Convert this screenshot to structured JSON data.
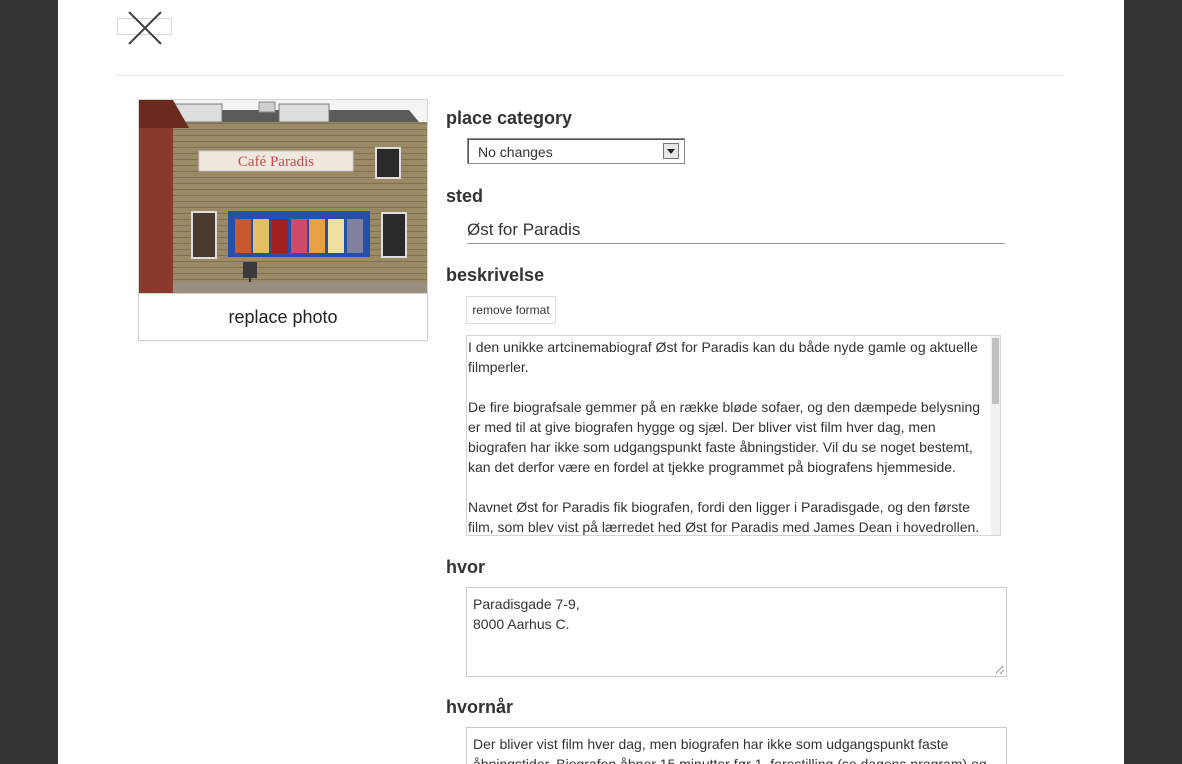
{
  "photo_card": {
    "replace_label": "replace photo",
    "photo_sign": "Café Paradis"
  },
  "form": {
    "category": {
      "label": "place category",
      "selected": "No changes"
    },
    "sted": {
      "label": "sted",
      "value": "Øst for Paradis"
    },
    "beskrivelse": {
      "label": "beskrivelse",
      "remove_format_label": "remove format",
      "paragraphs": [
        "I den unikke artcinemabiograf Øst for Paradis kan du både nyde gamle og aktuelle filmperler.",
        "De fire biografsale gemmer på en række bløde sofaer, og den dæmpede belysning er med til at give biografen hygge og sjæl. Der bliver vist film hver dag, men biografen har ikke som udgangspunkt faste åbningstider. Vil du se noget bestemt, kan det derfor være en fordel at tjekke programmet på biografens hjemmeside.",
        "Navnet Øst for Paradis fik biografen, fordi den ligger i Paradisgade, og den første film, som blev vist på lærredet hed Øst for Paradis med James Dean i hovedrollen."
      ]
    },
    "hvor": {
      "label": "hvor",
      "lines": [
        "Paradisgade 7-9,",
        "8000 Aarhus C."
      ]
    },
    "hvornaar": {
      "label": "hvornår",
      "lines": [
        "Der bliver vist film hver dag, men biografen har ikke som udgangspunkt faste",
        "åbningstider. Biografen åbner 15 minutter før 1. forestilling (se dagens program) og"
      ]
    }
  },
  "colors": {
    "backdrop": "#333333",
    "panel": "#ffffff",
    "text": "#333333",
    "border": "#d4d4d4"
  }
}
